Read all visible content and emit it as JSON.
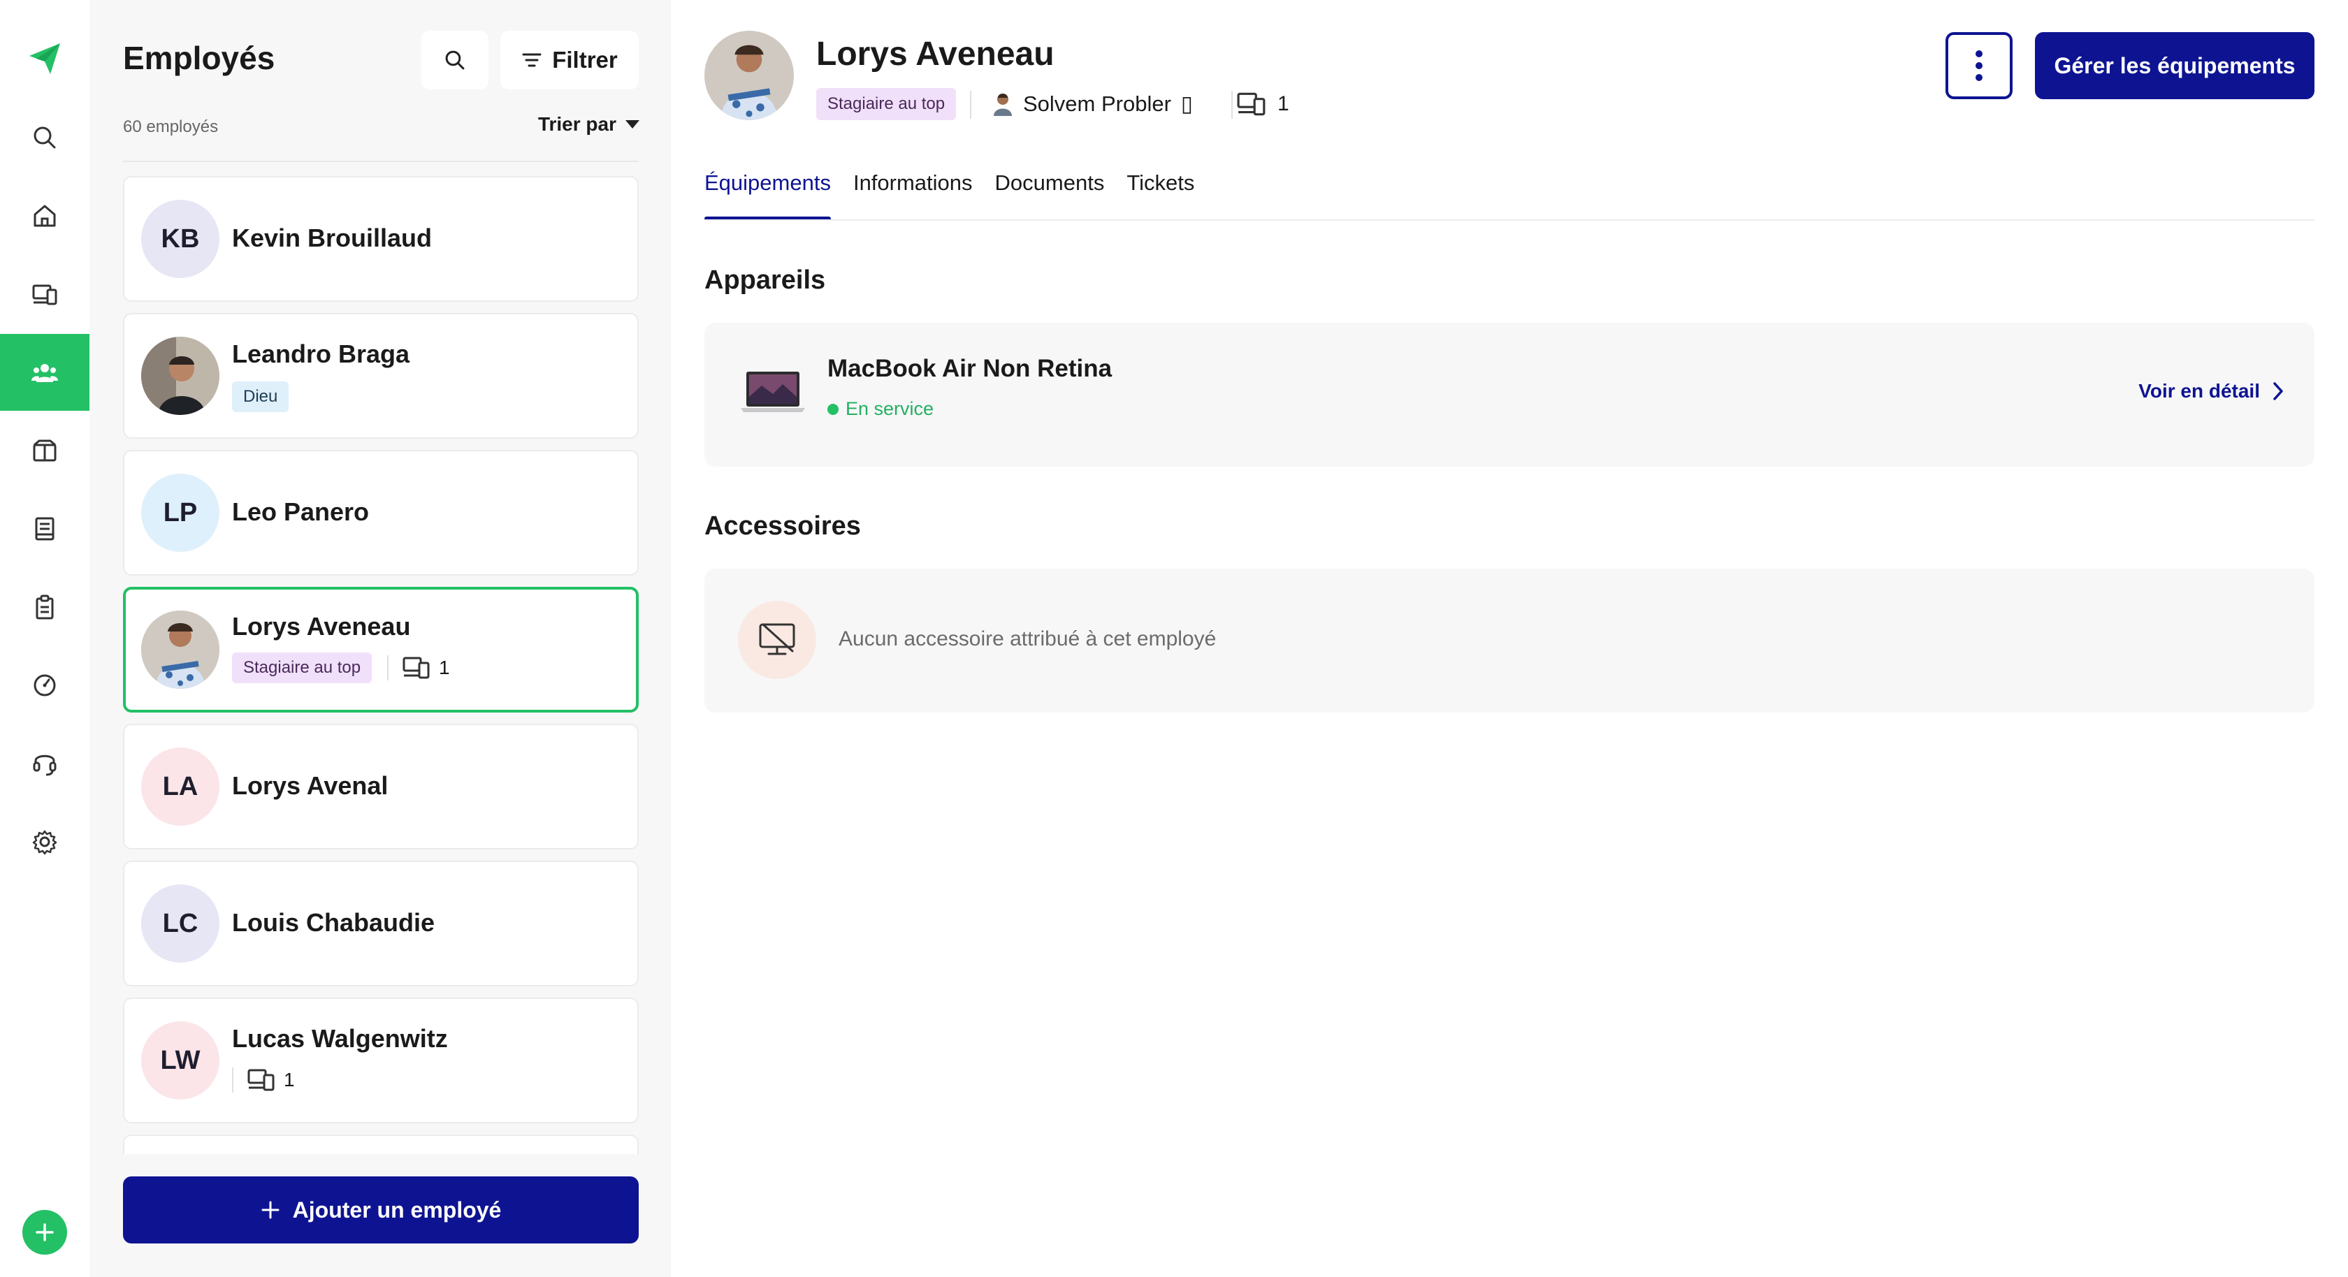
{
  "rail": {
    "icons": [
      "logo-icon",
      "search-icon",
      "home-icon",
      "devices-icon",
      "users-icon",
      "box-icon",
      "book-icon",
      "clipboard-icon",
      "dashboard-icon",
      "headset-icon",
      "gear-icon",
      "plus-icon"
    ],
    "active": "users-icon",
    "accent_color": "#23c065"
  },
  "list": {
    "title": "Employés",
    "filter_label": "Filtrer",
    "count_label": "60 employés",
    "sort_label": "Trier par",
    "employees": [
      {
        "initials": "KB",
        "name": "Kevin Brouillaud",
        "avatar_color": "#e6e6f5"
      },
      {
        "initials": "",
        "name": "Leandro Braga",
        "tag": "Dieu",
        "photo": true
      },
      {
        "initials": "LP",
        "name": "Leo Panero",
        "avatar_color": "#def0fb"
      },
      {
        "initials": "",
        "name": "Lorys Aveneau",
        "tag": "Stagiaire au top",
        "devices": "1",
        "photo": true,
        "selected": true
      },
      {
        "initials": "LA",
        "name": "Lorys Avenal",
        "avatar_color": "#fbe5e8"
      },
      {
        "initials": "LC",
        "name": "Louis Chabaudie",
        "avatar_color": "#e6e6f5"
      },
      {
        "initials": "LW",
        "name": "Lucas Walgenwitz",
        "devices": "1",
        "avatar_color": "#fbe5e8"
      }
    ],
    "add_button_label": "Ajouter un employé"
  },
  "detail": {
    "name": "Lorys Aveneau",
    "tag": "Stagiaire au top",
    "manager": "Solvem Probler",
    "manager_suffix": "▯",
    "device_count": "1",
    "manage_button_label": "Gérer les équipements",
    "tabs": [
      "Équipements",
      "Informations",
      "Documents",
      "Tickets"
    ],
    "active_tab": "Équipements",
    "devices_section": {
      "title": "Appareils",
      "device_name": "MacBook Air Non Retina",
      "status": "En service",
      "status_color": "#23c065",
      "link_label": "Voir en détail"
    },
    "accessories_section": {
      "title": "Accessoires",
      "empty_text": "Aucun accessoire attribué à cet employé"
    },
    "primary_color": "#0e1491"
  }
}
